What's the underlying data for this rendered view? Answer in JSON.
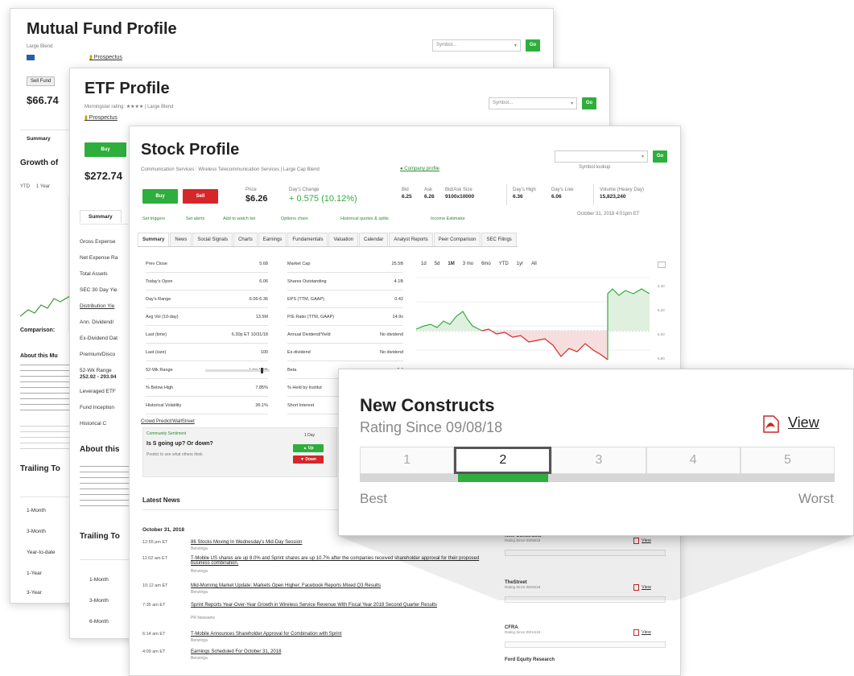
{
  "mutual_fund": {
    "title": "Mutual Fund Profile",
    "category": "Large Blend",
    "prospectus_link": "Prospectus",
    "symbol_placeholder": "Symbol...",
    "go": "Go",
    "sell_label": "Sell Fund",
    "price": "$66.74",
    "tab_summary": "Summary",
    "growth_heading": "Growth of",
    "range_labels": [
      "YTD",
      "1 Year"
    ],
    "comparison_label": "Comparison:",
    "about_heading": "About this Mu",
    "trailing_heading": "Trailing To",
    "trailing_rows": [
      "1-Month",
      "3-Month",
      "Year-to-date",
      "1-Year",
      "3-Year"
    ]
  },
  "etf": {
    "title": "ETF Profile",
    "rating_line": "Morningstar rating: ★★★★ | Large Blend",
    "prospectus_link": "Prospectus",
    "symbol_placeholder": "Symbol...",
    "go": "Go",
    "buy": "Buy",
    "price": "$272.74",
    "tab_summary": "Summary",
    "side_rows": [
      "Gross Expense",
      "Net Expense Ra",
      "Total Assets",
      "SEC 30 Day Yie",
      "Distribution Yie",
      "Ann. Dividend/",
      "Ex-Dividend Dat",
      "Premium/Disco",
      "52-Wk Range",
      "Leveraged ETF",
      "Fund Inception",
      "Historical C"
    ],
    "range_value": "252.92 - 293.94",
    "about_heading": "About this",
    "trailing_heading": "Trailing To",
    "trailing_rows": [
      "1-Month",
      "3-Month",
      "6-Month"
    ]
  },
  "stock": {
    "title": "Stock Profile",
    "sector_line": "Communication Services : Wireless Telecommunication Services | Large Cap Blend",
    "company_profile": "Company profile",
    "symbol_lookup": "Symbol lookup",
    "go": "Go",
    "buy": "Buy",
    "sell": "Sell",
    "price_label": "Price",
    "price": "$6.26",
    "change_label": "Day's Change",
    "change": "+ 0.575 (10.12%)",
    "bid_label": "Bid",
    "bid": "6.25",
    "ask_label": "Ask",
    "ask": "6.26",
    "bidask_label": "Bid/Ask Size",
    "bidask": "9100x10000",
    "high_label": "Day's High",
    "high": "6.36",
    "low_label": "Day's Low",
    "low": "6.06",
    "volume_label": "Volume (Heavy Day)",
    "volume": "15,823,240",
    "timestamp": "October 31, 2018 4:01pm ET",
    "quick_links": [
      "Set triggers",
      "Set alerts",
      "Add to watch list",
      "Options chain",
      "Historical quotes & splits",
      "Income Estimator"
    ],
    "tabs": [
      "Summary",
      "News",
      "Social Signals",
      "Charts",
      "Earnings",
      "Fundamentals",
      "Valuation",
      "Calendar",
      "Analyst Reports",
      "Peer Comparison",
      "SEC Filings"
    ],
    "left_table": [
      {
        "k": "Prev Close",
        "v": "5.68"
      },
      {
        "k": "Today's Open",
        "v": "6.06"
      },
      {
        "k": "Day's Range",
        "v": "6.06-6.36"
      },
      {
        "k": "Avg Vol (10-day)",
        "v": "13.5M"
      },
      {
        "k": "Last (time)",
        "v": "6.30p ET 10/31/18"
      },
      {
        "k": "Last (size)",
        "v": "100"
      },
      {
        "k": "52-Wk Range",
        "v": "Low  High"
      },
      {
        "k": "% Below High",
        "v": "7.85%"
      },
      {
        "k": "Historical Volatility",
        "v": "36.1%"
      }
    ],
    "right_table": [
      {
        "k": "Market Cap",
        "v": "25.5B"
      },
      {
        "k": "Shares Outstanding",
        "v": "4.1B"
      },
      {
        "k": "EPS (TTM, GAAP)",
        "v": "0.42"
      },
      {
        "k": "P/E Ratio (TTM, GAAP)",
        "v": "14.9x"
      },
      {
        "k": "Annual Dividend/Yield",
        "v": "No dividend"
      },
      {
        "k": "Ex-dividend",
        "v": "No dividend"
      },
      {
        "k": "Beta",
        "v": "0.4"
      },
      {
        "k": "% Held by Institut",
        "v": ""
      },
      {
        "k": "Short Interest",
        "v": ""
      }
    ],
    "chart_ranges": [
      "1d",
      "5d",
      "1M",
      "3 mo",
      "6mo",
      "YTD",
      "1yr",
      "All"
    ],
    "y_ticks": [
      "6.40",
      "6.20",
      "6.00",
      "5.80",
      "5.60"
    ],
    "crowd_link": "Crowd Predict/WallStreet",
    "community_label": "Community Sentiment",
    "question": "Is S going up? Or down?",
    "predict_hint": "Predict to see what others think",
    "vote_label": "1 Day",
    "up": "Up",
    "down": "Down",
    "latest_news": "Latest News",
    "news_date": "October 31, 2018",
    "news": [
      {
        "time": "12:55 pm ET",
        "head": "86 Stocks Moving In Wednesday's Mid-Day Session",
        "src": "Benzinga"
      },
      {
        "time": "11:02 am ET",
        "head": "T-Mobile US shares are up 8.0% and Sprint shares are up 10.7% after the companies received shareholder approval for their proposed business combination.",
        "src": "Benzinga"
      },
      {
        "time": "10:12 am ET",
        "head": "Mid-Morning Market Update: Markets Open Higher; Facebook Reports Mixed Q3 Results",
        "src": "Benzinga"
      },
      {
        "time": "7:35 am ET",
        "head": "Sprint Reports Year-Over-Year Growth in Wireless Service Revenue With Fiscal Year 2018 Second Quarter Results",
        "src": "PR Newswire"
      },
      {
        "time": "6:14 am ET",
        "head": "T-Mobile Announces Shareholder Approval for Combination with Sprint",
        "src": "Benzinga"
      },
      {
        "time": "4:09 am ET",
        "head": "Earnings Scheduled For October 31, 2018",
        "src": "Benzinga"
      }
    ],
    "mini_ratings": [
      {
        "name": "New Constructs",
        "since": "Rating Since 09/08/18"
      },
      {
        "name": "TheStreet",
        "since": "Rating Since 08/25/18"
      },
      {
        "name": "CFRA",
        "since": "Rating Since 09/14/18"
      },
      {
        "name": "Ford Equity Research",
        "since": ""
      }
    ],
    "mini_view": "View"
  },
  "zoom": {
    "title": "New Constructs",
    "subtitle": "Rating Since 09/08/18",
    "view": "View",
    "scale": [
      "1",
      "2",
      "3",
      "4",
      "5"
    ],
    "selected_index": 1,
    "best": "Best",
    "worst": "Worst"
  },
  "colors": {
    "green": "#2eae3c",
    "red": "#d6262a",
    "link_green": "#2a8a34"
  }
}
